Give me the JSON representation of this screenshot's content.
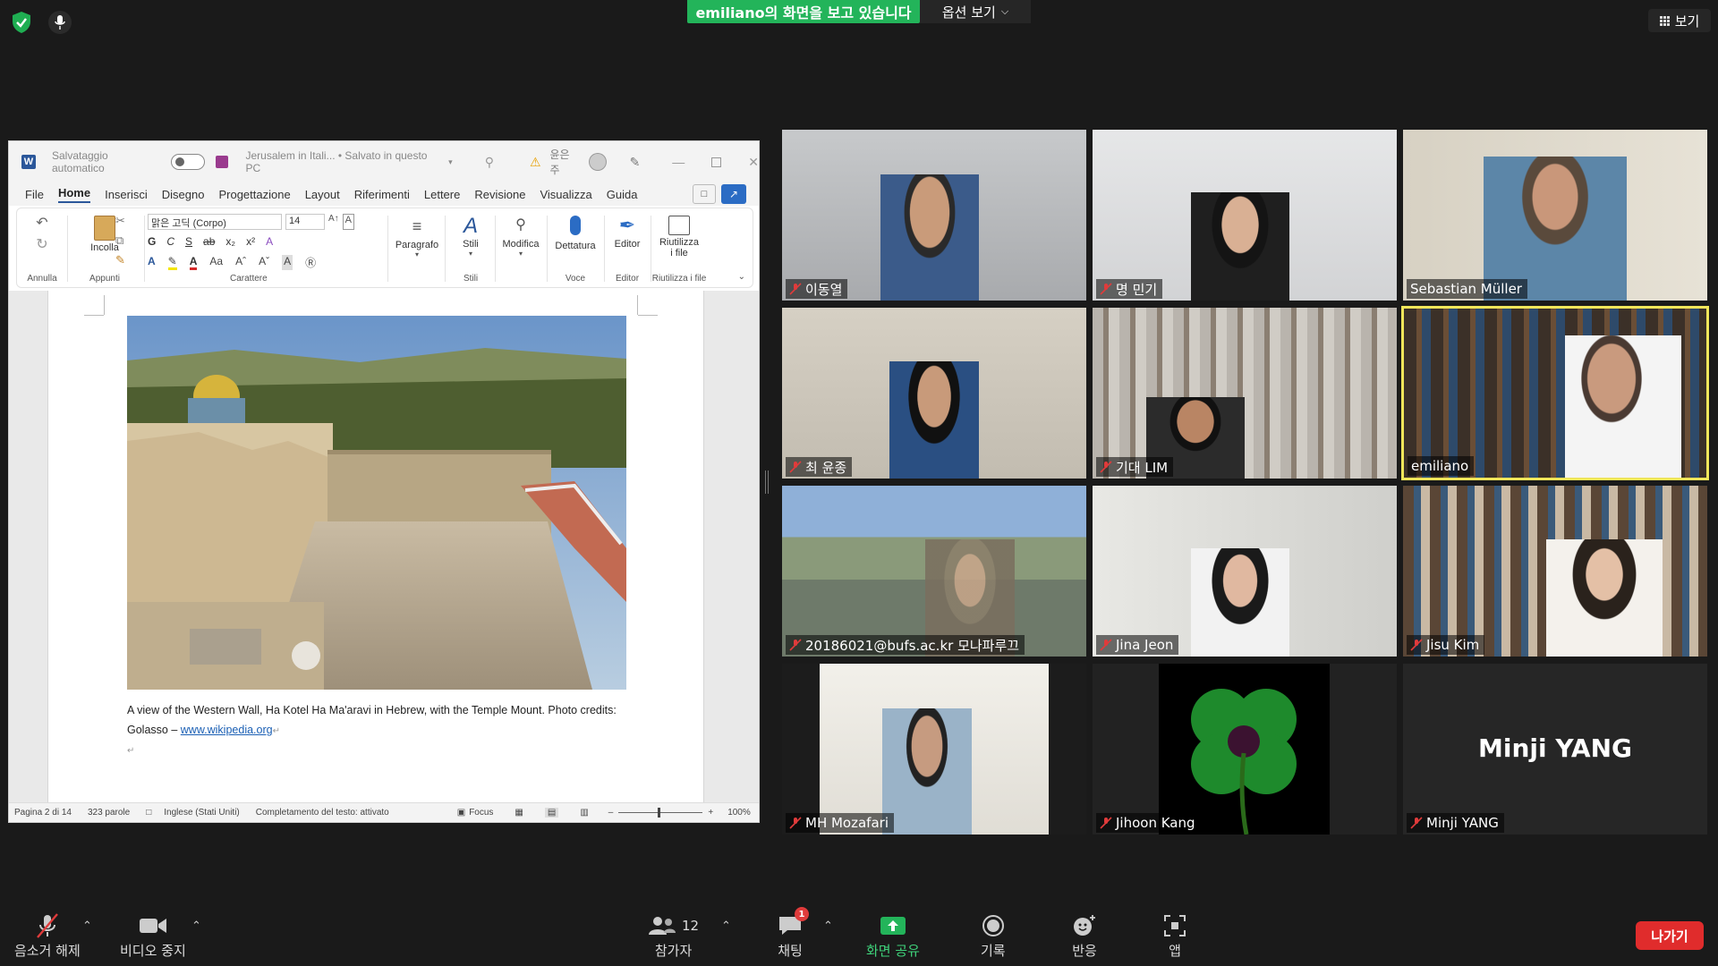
{
  "topbar": {
    "share_banner": "emiliano의 화면을 보고 있습니다",
    "view_options": "옵션 보기",
    "view_button": "보기"
  },
  "word": {
    "autosave_label": "Salvataggio automatico",
    "doc_title": "Jerusalem in Itali... • Salvato in questo PC",
    "user_name": "윤은주",
    "tabs": [
      "File",
      "Home",
      "Inserisci",
      "Disegno",
      "Progettazione",
      "Layout",
      "Riferimenti",
      "Lettere",
      "Revisione",
      "Visualizza",
      "Guida"
    ],
    "active_tab": "Home",
    "ribbon": {
      "undo_group": "Annulla",
      "paste_label": "Incolla",
      "clipboard_group": "Appunti",
      "font_name": "맑은 고딕 (Corpo)",
      "font_size": "14",
      "font_group": "Carattere",
      "paragraph_label": "Paragrafo",
      "styles_label": "Stili",
      "styles_group": "Stili",
      "edit_label": "Modifica",
      "dictate_label": "Dettatura",
      "voice_group": "Voce",
      "editor_label": "Editor",
      "editor_group": "Editor",
      "reuse_label_1": "Riutilizza",
      "reuse_label_2": "i file",
      "reuse_group": "Riutilizza i file",
      "bold": "G",
      "italic": "C",
      "underline": "S",
      "strike": "ab",
      "sub": "x₂",
      "sup": "x²"
    },
    "caption_line1": "A view of the Western Wall, Ha Kotel Ha Ma'aravi in Hebrew, with the Temple Mount. Photo credits:",
    "caption_line2_prefix": "Golasso – ",
    "caption_link": "www.wikipedia.org",
    "status": {
      "page": "Pagina 2 di 14",
      "words": "323 parole",
      "language": "Inglese (Stati Uniti)",
      "completion": "Completamento del testo: attivato",
      "focus": "Focus",
      "zoom": "100%"
    }
  },
  "participants": [
    {
      "name": "이동열",
      "muted": true
    },
    {
      "name": "명 민기",
      "muted": true
    },
    {
      "name": "Sebastian Müller",
      "muted": false
    },
    {
      "name": "최 윤종",
      "muted": true
    },
    {
      "name": "기대 LIM",
      "muted": true
    },
    {
      "name": "emiliano",
      "muted": false,
      "active_speaker": true
    },
    {
      "name": "20186021@bufs.ac.kr 모나파루끄",
      "muted": true
    },
    {
      "name": "Jina Jeon",
      "muted": true
    },
    {
      "name": "Jisu Kim",
      "muted": true
    },
    {
      "name": "MH Mozafari",
      "muted": true
    },
    {
      "name": "Jihoon Kang",
      "muted": true
    },
    {
      "name": "Minji YANG",
      "muted": true,
      "video_off": true
    }
  ],
  "no_video_name": "Minji YANG",
  "toolbar": {
    "unmute": "음소거 해제",
    "stop_video": "비디오 중지",
    "participants": "참가자",
    "participants_count": "12",
    "chat": "채팅",
    "chat_badge": "1",
    "share_screen": "화면 공유",
    "record": "기록",
    "reactions": "반응",
    "apps": "앱",
    "leave": "나가기"
  },
  "colors": {
    "share_green": "#23b45a",
    "active_speaker_border": "#f0e65a",
    "leave_red": "#e02c2c",
    "mute_red": "#e03b3b",
    "word_blue": "#2b579a"
  }
}
